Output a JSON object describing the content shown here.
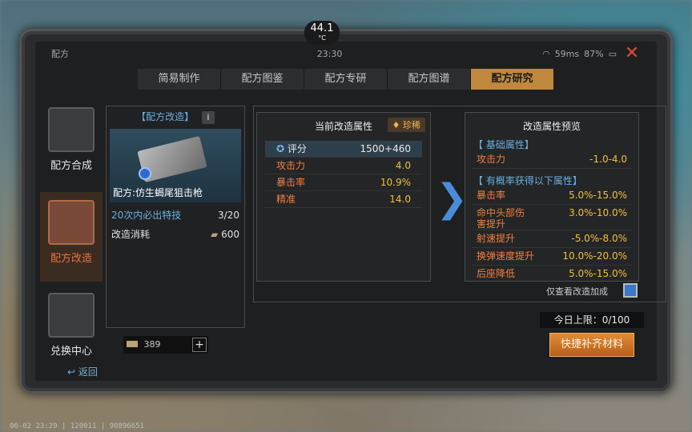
{
  "status": {
    "title": "配方",
    "time": "23:30",
    "ping": "59ms",
    "battery": "87%",
    "temperature": "44.1",
    "temp_unit": "°C"
  },
  "tabs": [
    "简易制作",
    "配方图鉴",
    "配方专研",
    "配方图谱",
    "配方研究"
  ],
  "active_tab": 4,
  "sidebar": [
    {
      "label": "配方合成"
    },
    {
      "label": "配方改造"
    },
    {
      "label": "兑换中心"
    }
  ],
  "left": {
    "title": "【配方改造】",
    "info_label": "i",
    "weapon_name": "配方:仿生蝎尾狙击枪",
    "guarantee_label": "20次内必出特技",
    "guarantee_value": "3/20",
    "cost_label": "改造消耗",
    "cost_value": "600"
  },
  "current": {
    "title": "当前改造属性",
    "rarity": "珍稀",
    "rows": [
      {
        "k": "评分",
        "v": "1500+460"
      },
      {
        "k": "攻击力",
        "v": "4.0"
      },
      {
        "k": "暴击率",
        "v": "10.9%"
      },
      {
        "k": "精准",
        "v": "14.0"
      }
    ]
  },
  "preview": {
    "title": "改造属性预览",
    "base_section": "【 基础属性】",
    "base_rows": [
      {
        "k": "攻击力",
        "v": "-1.0-4.0"
      }
    ],
    "chance_section": "【 有概率获得以下属性】",
    "chance_rows": [
      {
        "k": "暴击率",
        "v": "5.0%-15.0%"
      },
      {
        "k": "命中头部伤害提升",
        "v": "3.0%-10.0%"
      },
      {
        "k": "射速提升",
        "v": "-5.0%-8.0%"
      },
      {
        "k": "换弹速度提升",
        "v": "10.0%-20.0%"
      },
      {
        "k": "后座降低",
        "v": "5.0%-15.0%"
      }
    ]
  },
  "only_view_label": "仅查看改造加成",
  "daily_limit": "今日上限：0/100",
  "material_count": "389",
  "refill_button": "快捷补齐材料",
  "back_label": "返回",
  "bottom_info": "06-02 23:29 | 120011 | 90896651"
}
